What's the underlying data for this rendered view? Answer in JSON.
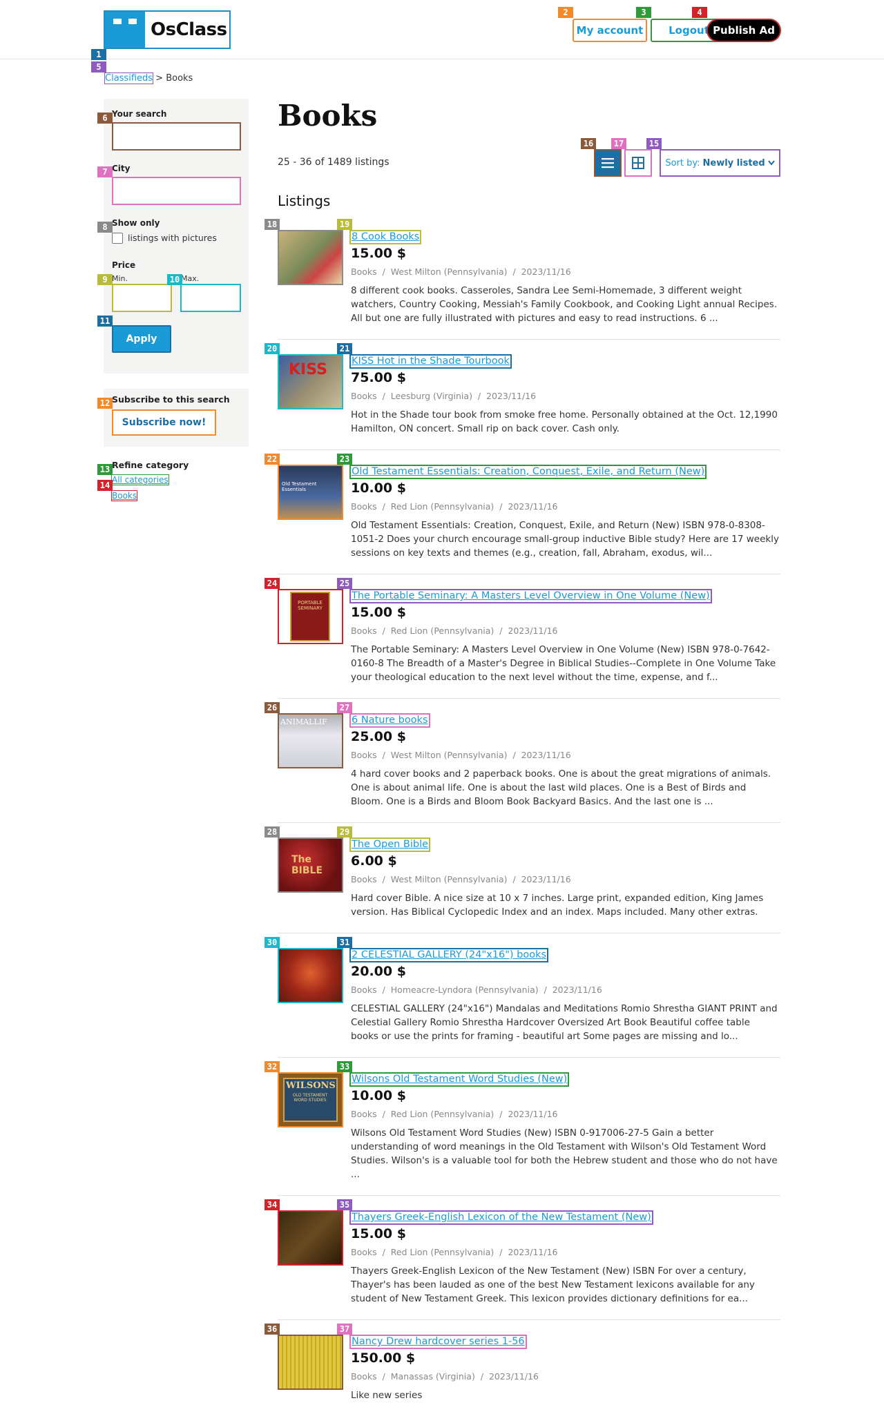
{
  "header": {
    "logo_text": "OsClass",
    "my_account": "My account",
    "logout": "Logout",
    "publish_ad": "Publish Ad"
  },
  "breadcrumb": {
    "root": "Classifieds",
    "separator": " > ",
    "current": "Books"
  },
  "sidebar": {
    "your_search_label": "Your search",
    "your_search_value": "",
    "city_label": "City",
    "city_value": "",
    "show_only_label": "Show only",
    "pictures_label": "listings with pictures",
    "pictures_checked": false,
    "price_label": "Price",
    "min_label": "Min.",
    "max_label": "Max.",
    "apply_label": "Apply",
    "subscribe_title": "Subscribe to this search",
    "subscribe_button": "Subscribe now!",
    "refine_title": "Refine category",
    "categories": [
      "All categories",
      "Books"
    ]
  },
  "main": {
    "title": "Books",
    "count_text": "25 - 36 of 1489 listings",
    "sort_prefix": "Sort by:",
    "sort_value": "Newly listed",
    "listings_heading": "Listings"
  },
  "colors": {
    "accent": "#1a9bd5",
    "dark_accent": "#1d6fa3",
    "publish_bg": "#000000"
  },
  "listings": [
    {
      "title": "8 Cook Books",
      "price": "15.00 $",
      "category": "Books",
      "location": "West Milton (Pennsylvania)",
      "date": "2023/11/16",
      "description": "8 different cook books. Casseroles, Sandra Lee Semi-Homemade, 3 different weight watchers, Country Cooking, Messiah's Family Cookbook, and Cooking Light annual Recipes. All but one are fully illustrated with pictures and easy to read instructions. 6 ..."
    },
    {
      "title": "KISS Hot in the Shade Tourbook",
      "price": "75.00 $",
      "category": "Books",
      "location": "Leesburg (Virginia)",
      "date": "2023/11/16",
      "description": "Hot in the Shade tour book from smoke free home. Personally obtained at the Oct. 12,1990 Hamilton, ON concert. Small rip on back cover. Cash only."
    },
    {
      "title": "Old Testament Essentials: Creation, Conquest, Exile, and Return (New)",
      "price": "10.00 $",
      "category": "Books",
      "location": "Red Lion (Pennsylvania)",
      "date": "2023/11/16",
      "description": "Old Testament Essentials: Creation, Conquest, Exile, and Return (New) ISBN 978-0-8308-1051-2 Does your church encourage small-group inductive Bible study? Here are 17 weekly sessions on key texts and themes (e.g., creation, fall, Abraham, exodus, wil..."
    },
    {
      "title": "The Portable Seminary: A Masters Level Overview in One Volume (New)",
      "price": "15.00 $",
      "category": "Books",
      "location": "Red Lion (Pennsylvania)",
      "date": "2023/11/16",
      "description": "The Portable Seminary: A Masters Level Overview in One Volume (New) ISBN 978-0-7642-0160-8 The Breadth of a Master's Degree in Biblical Studies--Complete in One Volume Take your theological education to the next level without the time, expense, and f..."
    },
    {
      "title": "6 Nature books",
      "price": "25.00 $",
      "category": "Books",
      "location": "West Milton (Pennsylvania)",
      "date": "2023/11/16",
      "description": "4 hard cover books and 2 paperback books. One is about the great migrations of animals. One is about animal life. One is about the last wild places. One is a Best of Birds and Bloom. One is a Birds and Bloom Book Backyard Basics. And the last one is ..."
    },
    {
      "title": "The Open Bible",
      "price": "6.00 $",
      "category": "Books",
      "location": "West Milton (Pennsylvania)",
      "date": "2023/11/16",
      "description": "Hard cover Bible. A nice size at 10 x 7 inches. Large print, expanded edition, King James version. Has Biblical Cyclopedic Index and an index. Maps included. Many other extras."
    },
    {
      "title": "2 CELESTIAL GALLERY (24\"x16\") books",
      "price": "20.00 $",
      "category": "Books",
      "location": "Homeacre-Lyndora (Pennsylvania)",
      "date": "2023/11/16",
      "description": "CELESTIAL GALLERY (24\"x16\") Mandalas and Meditations Romio Shrestha GIANT PRINT and Celestial Gallery Romio Shrestha Hardcover Oversized Art Book Beautiful coffee table books or use the prints for framing - beautiful art Some pages are missing and lo..."
    },
    {
      "title": "Wilsons Old Testament Word Studies (New)",
      "price": "10.00 $",
      "category": "Books",
      "location": "Red Lion (Pennsylvania)",
      "date": "2023/11/16",
      "description": "Wilsons Old Testament Word Studies (New) ISBN 0-917006-27-5 Gain a better understanding of word meanings in the Old Testament with Wilson's Old Testament Word Studies. Wilson's is a valuable tool for both the Hebrew student and those who do not have ..."
    },
    {
      "title": "Thayers Greek-English Lexicon of the New Testament (New)",
      "price": "15.00 $",
      "category": "Books",
      "location": "Red Lion (Pennsylvania)",
      "date": "2023/11/16",
      "description": "Thayers Greek-English Lexicon of the New Testament (New) ISBN For over a century, Thayer's has been lauded as one of the best New Testament lexicons available for any student of New Testament Greek. This lexicon provides dictionary definitions for ea..."
    },
    {
      "title": "Nancy Drew hardcover series 1-56",
      "price": "150.00 $",
      "category": "Books",
      "location": "Manassas (Virginia)",
      "date": "2023/11/16",
      "description": "Like new series"
    }
  ],
  "thumb_labels": {
    "portable": "PORTABLE SEMINARY",
    "animal": "ANIMALLIF",
    "bible": "The BIBLE",
    "wilsons": "WILSONS",
    "wilsons_sub": "OLD TESTAMENT WORD STUDIES",
    "kiss": "KISS",
    "ot_essentials": "Old Testament Essentials"
  },
  "badges": [
    "1",
    "2",
    "3",
    "4",
    "5",
    "6",
    "7",
    "8",
    "9",
    "10",
    "11",
    "12",
    "13",
    "14",
    "15",
    "16",
    "17",
    "18",
    "19",
    "20",
    "21",
    "22",
    "23",
    "24",
    "25",
    "26",
    "27",
    "28",
    "29",
    "30",
    "31",
    "32",
    "33",
    "34",
    "35",
    "36",
    "37"
  ]
}
